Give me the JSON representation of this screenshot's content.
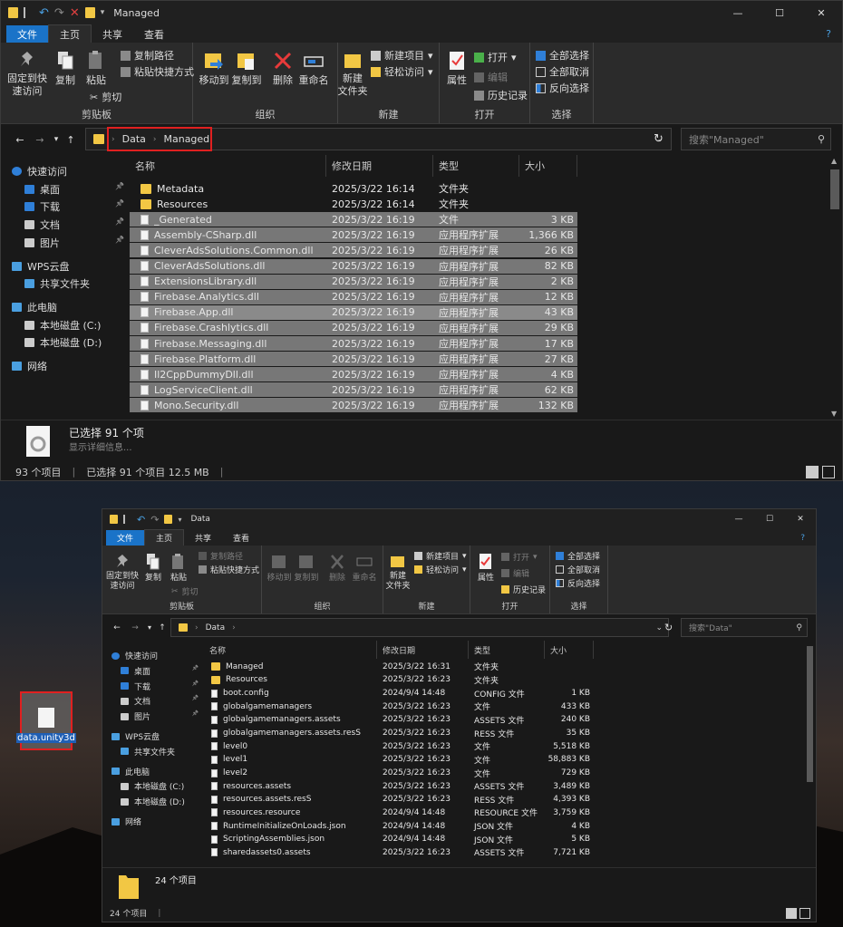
{
  "colors": {
    "accent": "#1a73c8",
    "selection": "#777777",
    "highlight_box": "#e02020",
    "folder": "#f2c744"
  },
  "top": {
    "title": "Managed",
    "controls": [
      "—",
      "☐",
      "✕"
    ],
    "help": "?",
    "tabs": [
      "文件",
      "主页",
      "共享",
      "查看"
    ],
    "ribbon": {
      "pin": "固定到快\n速访问",
      "copy": "复制",
      "paste": "粘贴",
      "copy_path": "复制路径",
      "paste_shortcut": "粘贴快捷方式",
      "cut": "剪切",
      "g1": "剪贴板",
      "move_to": "移动到",
      "copy_to": "复制到",
      "delete": "删除",
      "rename": "重命名",
      "g2": "组织",
      "new_folder": "新建\n文件夹",
      "new_item": "新建项目",
      "easy_access": "轻松访问",
      "g3": "新建",
      "properties": "属性",
      "open": "打开",
      "edit": "编辑",
      "history": "历史记录",
      "g4": "打开",
      "select_all": "全部选择",
      "select_none": "全部取消",
      "invert": "反向选择",
      "g5": "选择"
    },
    "path": [
      "Data",
      "Managed"
    ],
    "search_placeholder": "搜索\"Managed\"",
    "nav": [
      "快速访问",
      "桌面",
      "下载",
      "文档",
      "图片",
      "WPS云盘",
      "共享文件夹",
      "此电脑",
      "本地磁盘 (C:)",
      "本地磁盘 (D:)",
      "网络"
    ],
    "cols": [
      "名称",
      "修改日期",
      "类型",
      "大小"
    ],
    "rows": [
      {
        "n": "Metadata",
        "d": "2025/3/22 16:14",
        "t": "文件夹",
        "s": "",
        "f": "folder",
        "sel": false
      },
      {
        "n": "Resources",
        "d": "2025/3/22 16:14",
        "t": "文件夹",
        "s": "",
        "f": "folder",
        "sel": false
      },
      {
        "n": "_Generated",
        "d": "2025/3/22 16:19",
        "t": "文件",
        "s": "3 KB",
        "f": "doc",
        "sel": true
      },
      {
        "n": "Assembly-CSharp.dll",
        "d": "2025/3/22 16:19",
        "t": "应用程序扩展",
        "s": "1,366 KB",
        "f": "doc",
        "sel": true
      },
      {
        "n": "CleverAdsSolutions.Common.dll",
        "d": "2025/3/22 16:19",
        "t": "应用程序扩展",
        "s": "26 KB",
        "f": "doc",
        "sel": true
      },
      {
        "n": "CleverAdsSolutions.dll",
        "d": "2025/3/22 16:19",
        "t": "应用程序扩展",
        "s": "82 KB",
        "f": "doc",
        "sel": true
      },
      {
        "n": "ExtensionsLibrary.dll",
        "d": "2025/3/22 16:19",
        "t": "应用程序扩展",
        "s": "2 KB",
        "f": "doc",
        "sel": true
      },
      {
        "n": "Firebase.Analytics.dll",
        "d": "2025/3/22 16:19",
        "t": "应用程序扩展",
        "s": "12 KB",
        "f": "doc",
        "sel": true
      },
      {
        "n": "Firebase.App.dll",
        "d": "2025/3/22 16:19",
        "t": "应用程序扩展",
        "s": "43 KB",
        "f": "doc",
        "sel": true,
        "hov": true
      },
      {
        "n": "Firebase.Crashlytics.dll",
        "d": "2025/3/22 16:19",
        "t": "应用程序扩展",
        "s": "29 KB",
        "f": "doc",
        "sel": true
      },
      {
        "n": "Firebase.Messaging.dll",
        "d": "2025/3/22 16:19",
        "t": "应用程序扩展",
        "s": "17 KB",
        "f": "doc",
        "sel": true
      },
      {
        "n": "Firebase.Platform.dll",
        "d": "2025/3/22 16:19",
        "t": "应用程序扩展",
        "s": "27 KB",
        "f": "doc",
        "sel": true
      },
      {
        "n": "Il2CppDummyDll.dll",
        "d": "2025/3/22 16:19",
        "t": "应用程序扩展",
        "s": "4 KB",
        "f": "doc",
        "sel": true
      },
      {
        "n": "LogServiceClient.dll",
        "d": "2025/3/22 16:19",
        "t": "应用程序扩展",
        "s": "62 KB",
        "f": "doc",
        "sel": true
      },
      {
        "n": "Mono.Security.dll",
        "d": "2025/3/22 16:19",
        "t": "应用程序扩展",
        "s": "132 KB",
        "f": "doc",
        "sel": true
      }
    ],
    "detail_title": "已选择 91 个项",
    "detail_sub": "显示详细信息...",
    "status": [
      "93 个项目",
      "已选择 91 个项目  12.5 MB"
    ]
  },
  "bottom": {
    "title": "Data",
    "controls": [
      "—",
      "☐",
      "✕"
    ],
    "help": "?",
    "tabs": [
      "文件",
      "主页",
      "共享",
      "查看"
    ],
    "path": [
      "Data"
    ],
    "search_placeholder": "搜索\"Data\"",
    "nav": [
      "快速访问",
      "桌面",
      "下载",
      "文档",
      "图片",
      "WPS云盘",
      "共享文件夹",
      "此电脑",
      "本地磁盘 (C:)",
      "本地磁盘 (D:)",
      "网络"
    ],
    "cols": [
      "名称",
      "修改日期",
      "类型",
      "大小"
    ],
    "rows": [
      {
        "n": "Managed",
        "d": "2025/3/22 16:31",
        "t": "文件夹",
        "s": "",
        "f": "folder"
      },
      {
        "n": "Resources",
        "d": "2025/3/22 16:23",
        "t": "文件夹",
        "s": "",
        "f": "folder"
      },
      {
        "n": "boot.config",
        "d": "2024/9/4 14:48",
        "t": "CONFIG 文件",
        "s": "1 KB",
        "f": "doc"
      },
      {
        "n": "globalgamemanagers",
        "d": "2025/3/22 16:23",
        "t": "文件",
        "s": "433 KB",
        "f": "doc"
      },
      {
        "n": "globalgamemanagers.assets",
        "d": "2025/3/22 16:23",
        "t": "ASSETS 文件",
        "s": "240 KB",
        "f": "doc"
      },
      {
        "n": "globalgamemanagers.assets.resS",
        "d": "2025/3/22 16:23",
        "t": "RESS 文件",
        "s": "35 KB",
        "f": "doc"
      },
      {
        "n": "level0",
        "d": "2025/3/22 16:23",
        "t": "文件",
        "s": "5,518 KB",
        "f": "doc"
      },
      {
        "n": "level1",
        "d": "2025/3/22 16:23",
        "t": "文件",
        "s": "58,883 KB",
        "f": "doc"
      },
      {
        "n": "level2",
        "d": "2025/3/22 16:23",
        "t": "文件",
        "s": "729 KB",
        "f": "doc"
      },
      {
        "n": "resources.assets",
        "d": "2025/3/22 16:23",
        "t": "ASSETS 文件",
        "s": "3,489 KB",
        "f": "doc"
      },
      {
        "n": "resources.assets.resS",
        "d": "2025/3/22 16:23",
        "t": "RESS 文件",
        "s": "4,393 KB",
        "f": "doc"
      },
      {
        "n": "resources.resource",
        "d": "2024/9/4 14:48",
        "t": "RESOURCE 文件",
        "s": "3,759 KB",
        "f": "doc"
      },
      {
        "n": "RuntimeInitializeOnLoads.json",
        "d": "2024/9/4 14:48",
        "t": "JSON 文件",
        "s": "4 KB",
        "f": "doc"
      },
      {
        "n": "ScriptingAssemblies.json",
        "d": "2024/9/4 14:48",
        "t": "JSON 文件",
        "s": "5 KB",
        "f": "doc"
      },
      {
        "n": "sharedassets0.assets",
        "d": "2025/3/22 16:23",
        "t": "ASSETS 文件",
        "s": "7,721 KB",
        "f": "doc"
      }
    ],
    "detail_title": "24 个项目",
    "status": [
      "24 个项目"
    ]
  },
  "desktop_icon": "data.unity3d"
}
